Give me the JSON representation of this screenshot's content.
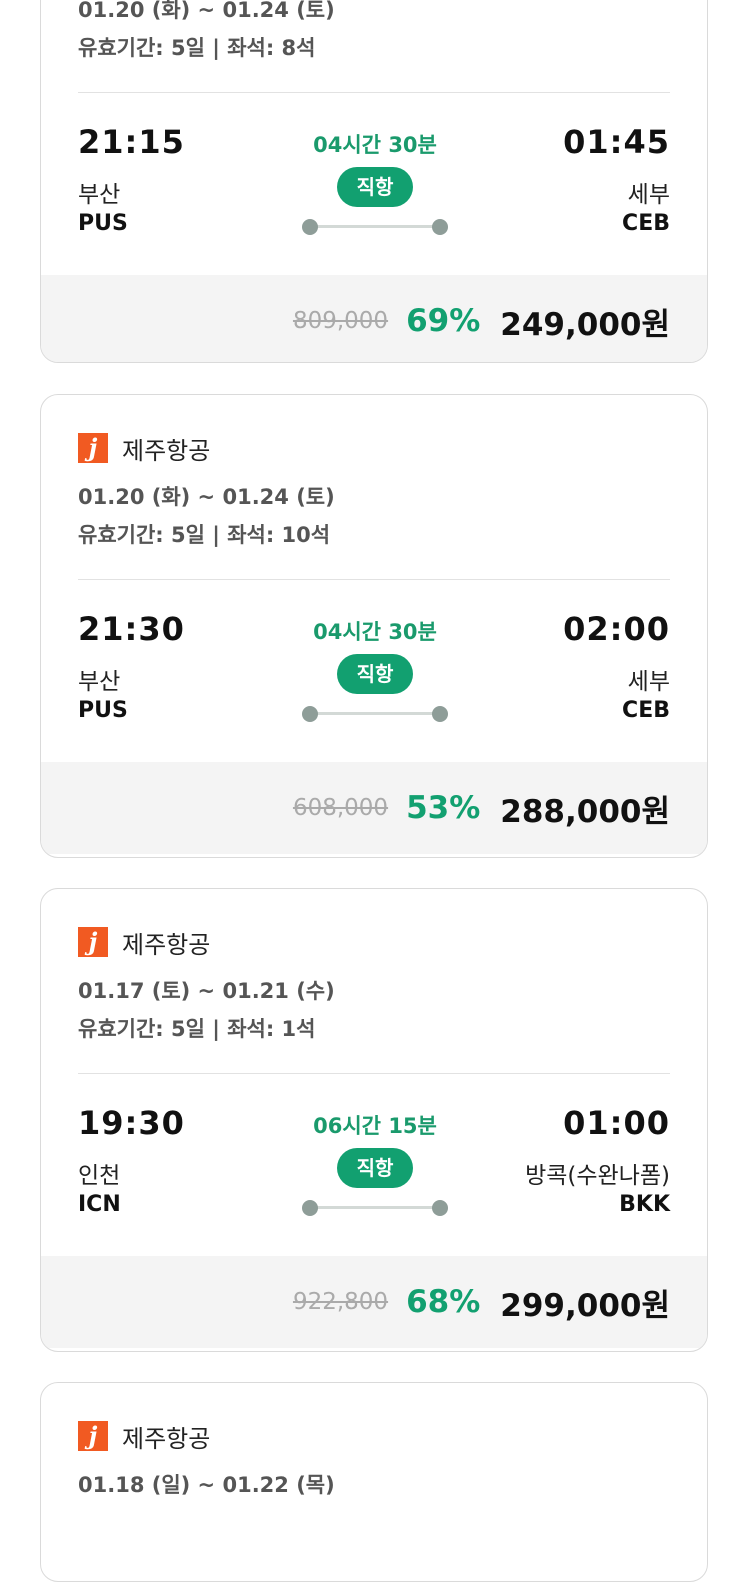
{
  "cards": [
    {
      "airline": "",
      "dates": "01.20 (화) ~ 01.24 (토)",
      "validity": "유효기간: 5일 | 좌석: 8석",
      "dep_time": "21:15",
      "dep_city": "부산",
      "dep_code": "PUS",
      "arr_time": "01:45",
      "arr_city": "세부",
      "arr_code": "CEB",
      "duration": "04시간 30분",
      "direct": "직항",
      "orig_price": "809,000",
      "discount": "69%",
      "price": "249,000원"
    },
    {
      "airline": "제주항공",
      "dates": "01.20 (화) ~ 01.24 (토)",
      "validity": "유효기간: 5일 | 좌석: 10석",
      "dep_time": "21:30",
      "dep_city": "부산",
      "dep_code": "PUS",
      "arr_time": "02:00",
      "arr_city": "세부",
      "arr_code": "CEB",
      "duration": "04시간 30분",
      "direct": "직항",
      "orig_price": "608,000",
      "discount": "53%",
      "price": "288,000원"
    },
    {
      "airline": "제주항공",
      "dates": "01.17 (토) ~ 01.21 (수)",
      "validity": "유효기간: 5일 | 좌석: 1석",
      "dep_time": "19:30",
      "dep_city": "인천",
      "dep_code": "ICN",
      "arr_time": "01:00",
      "arr_city": "방콕(수완나폼)",
      "arr_code": "BKK",
      "duration": "06시간 15분",
      "direct": "직항",
      "orig_price": "922,800",
      "discount": "68%",
      "price": "299,000원"
    },
    {
      "airline": "제주항공",
      "dates": "01.18 (일) ~ 01.22 (목)"
    }
  ],
  "logo_letter": "j",
  "colors": {
    "accent": "#12a070",
    "logo": "#f15a22"
  }
}
